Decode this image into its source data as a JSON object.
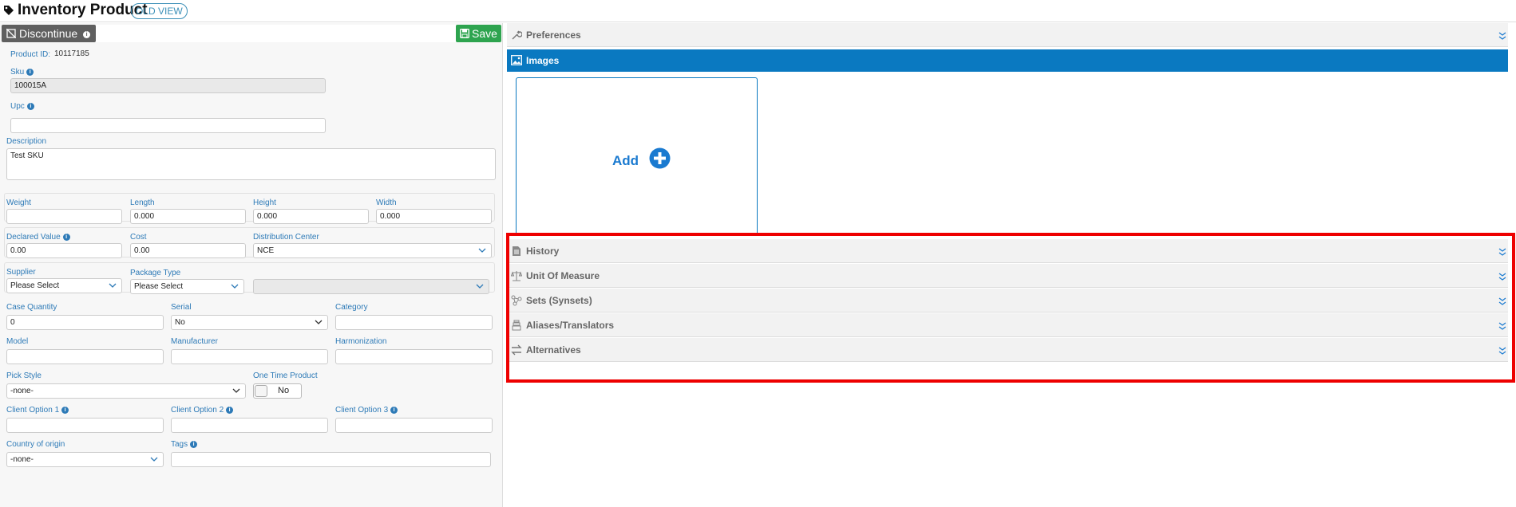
{
  "page": {
    "title": "Inventory Product",
    "old_view": "OLD VIEW"
  },
  "toolbar": {
    "discontinue_label": "Discontinue",
    "save_label": "Save"
  },
  "product": {
    "id_label": "Product ID:",
    "id_value": "10117185",
    "sku_label": "Sku",
    "sku_value": "100015A",
    "upc_label": "Upc",
    "upc_value": "",
    "description_label": "Description",
    "description_value": "Test SKU"
  },
  "dimensions": {
    "weight_label": "Weight",
    "weight_value": "",
    "length_label": "Length",
    "length_value": "0.000",
    "height_label": "Height",
    "height_value": "0.000",
    "width_label": "Width",
    "width_value": "0.000"
  },
  "values": {
    "declared_label": "Declared Value",
    "declared_value": "0.00",
    "cost_label": "Cost",
    "cost_value": "0.00",
    "dc_label": "Distribution Center",
    "dc_value": "NCE"
  },
  "supply": {
    "supplier_label": "Supplier",
    "supplier_value": "Please Select",
    "package_label": "Package Type",
    "package_value": "Please Select",
    "extra_value": ""
  },
  "details": {
    "case_qty_label": "Case Quantity",
    "case_qty_value": "0",
    "serial_label": "Serial",
    "serial_value": "No",
    "category_label": "Category",
    "category_value": "",
    "model_label": "Model",
    "model_value": "",
    "manufacturer_label": "Manufacturer",
    "manufacturer_value": "",
    "harmonization_label": "Harmonization",
    "harmonization_value": "",
    "pick_style_label": "Pick Style",
    "pick_style_value": "-none-",
    "one_time_label": "One Time Product",
    "one_time_value": "No",
    "client1_label": "Client Option 1",
    "client1_value": "",
    "client2_label": "Client Option 2",
    "client2_value": "",
    "client3_label": "Client Option 3",
    "client3_value": "",
    "country_label": "Country of origin",
    "country_value": "-none-",
    "tags_label": "Tags",
    "tags_value": ""
  },
  "right": {
    "preferences": "Preferences",
    "images": "Images",
    "add_label": "Add",
    "sections": [
      "History",
      "Unit Of Measure",
      "Sets (Synsets)",
      "Aliases/Translators",
      "Alternatives"
    ]
  },
  "colors": {
    "accent": "#0a79c1",
    "save": "#2ea44f",
    "highlight": "#e00000"
  }
}
